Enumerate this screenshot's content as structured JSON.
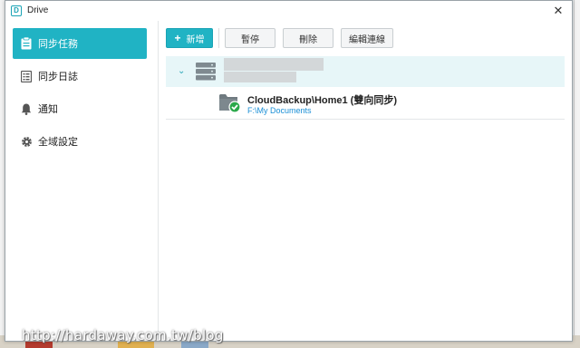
{
  "window": {
    "title": "Drive",
    "app_icon_letter": "D"
  },
  "sidebar": {
    "items": [
      {
        "label": "同步任務",
        "icon": "clipboard-icon",
        "active": true
      },
      {
        "label": "同步日誌",
        "icon": "list-icon",
        "active": false
      },
      {
        "label": "通知",
        "icon": "bell-icon",
        "active": false
      },
      {
        "label": "全域設定",
        "icon": "gear-icon",
        "active": false
      }
    ]
  },
  "toolbar": {
    "add_label": "新增",
    "add_icon": "+",
    "pause_label": "暫停",
    "delete_label": "刪除",
    "edit_label": "編輯連線"
  },
  "tasks": {
    "group": {
      "icon": "server-icon"
    },
    "items": [
      {
        "name": "CloudBackup\\Home1 (雙向同步)",
        "path": "F:\\My Documents",
        "status": "synced"
      }
    ]
  },
  "watermark": "http://hardaway.com.tw/blog",
  "colors": {
    "accent": "#20b3c4",
    "link": "#1a8fd6",
    "success": "#2aa84a"
  }
}
